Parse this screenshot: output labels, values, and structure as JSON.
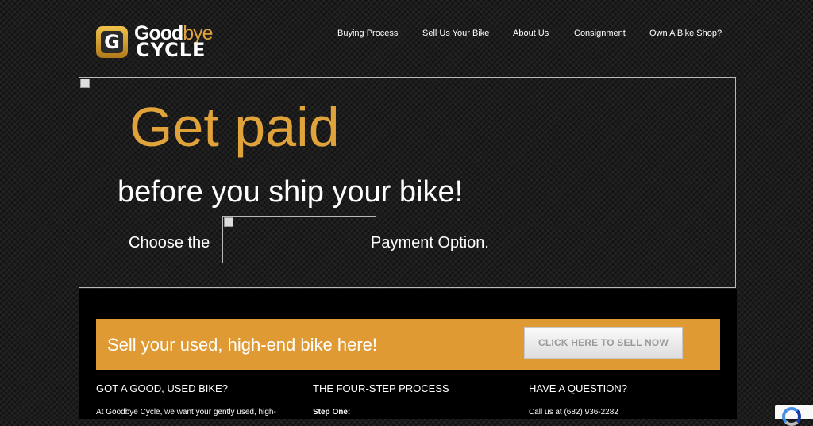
{
  "header": {
    "logo": {
      "word1": "Good",
      "word2": "bye",
      "word3": "CYCLE",
      "mark_letter": "G"
    },
    "nav": [
      {
        "label": "Buying Process"
      },
      {
        "label": "Sell Us Your Bike"
      },
      {
        "label": "About Us"
      },
      {
        "label": "Consignment"
      },
      {
        "label": "Own A Bike Shop?"
      }
    ]
  },
  "hero": {
    "title": "Get paid",
    "subtitle": "before you ship your bike!",
    "choose_text": "Choose the",
    "option_text": "Payment Option."
  },
  "cta": {
    "text": "Sell your used, high-end bike here!",
    "button_label": "CLICK HERE TO SELL NOW"
  },
  "columns": [
    {
      "heading": "GOT A GOOD, USED BIKE?",
      "text": "At Goodbye Cycle, we want your gently used, high-"
    },
    {
      "heading": "THE FOUR-STEP PROCESS",
      "text": "Step One:"
    },
    {
      "heading": "HAVE A QUESTION?",
      "text": "Call us at (682) 936-2282"
    }
  ],
  "colors": {
    "accent_orange": "#e09a34",
    "background": "#1c1c1c",
    "button_text": "#9a9a9a"
  },
  "icons": {
    "recaptcha": "recaptcha-icon",
    "broken_image": "broken-image-icon"
  }
}
